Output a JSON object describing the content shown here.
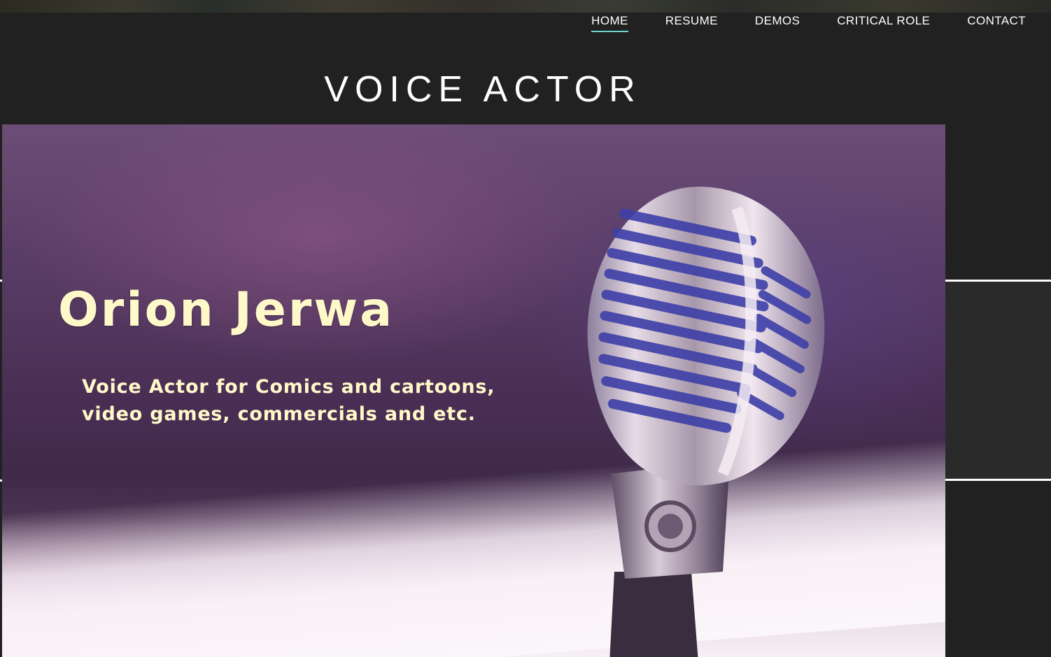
{
  "nav": {
    "items": [
      {
        "label": "HOME",
        "active": true
      },
      {
        "label": "RESUME",
        "active": false
      },
      {
        "label": "DEMOS",
        "active": false
      },
      {
        "label": "CRITICAL ROLE",
        "active": false
      },
      {
        "label": "CONTACT",
        "active": false
      }
    ],
    "active_underline_color": "#6fd3d0"
  },
  "page": {
    "title": "VOICE ACTOR",
    "background_color": "#212121"
  },
  "hero": {
    "name": "Orion Jerwa",
    "tagline_line1": "Voice Actor for Comics and cartoons,",
    "tagline_line2": "video games, commercials and etc.",
    "text_color": "#fff9c9",
    "image_icon": "vintage-microphone-icon"
  }
}
